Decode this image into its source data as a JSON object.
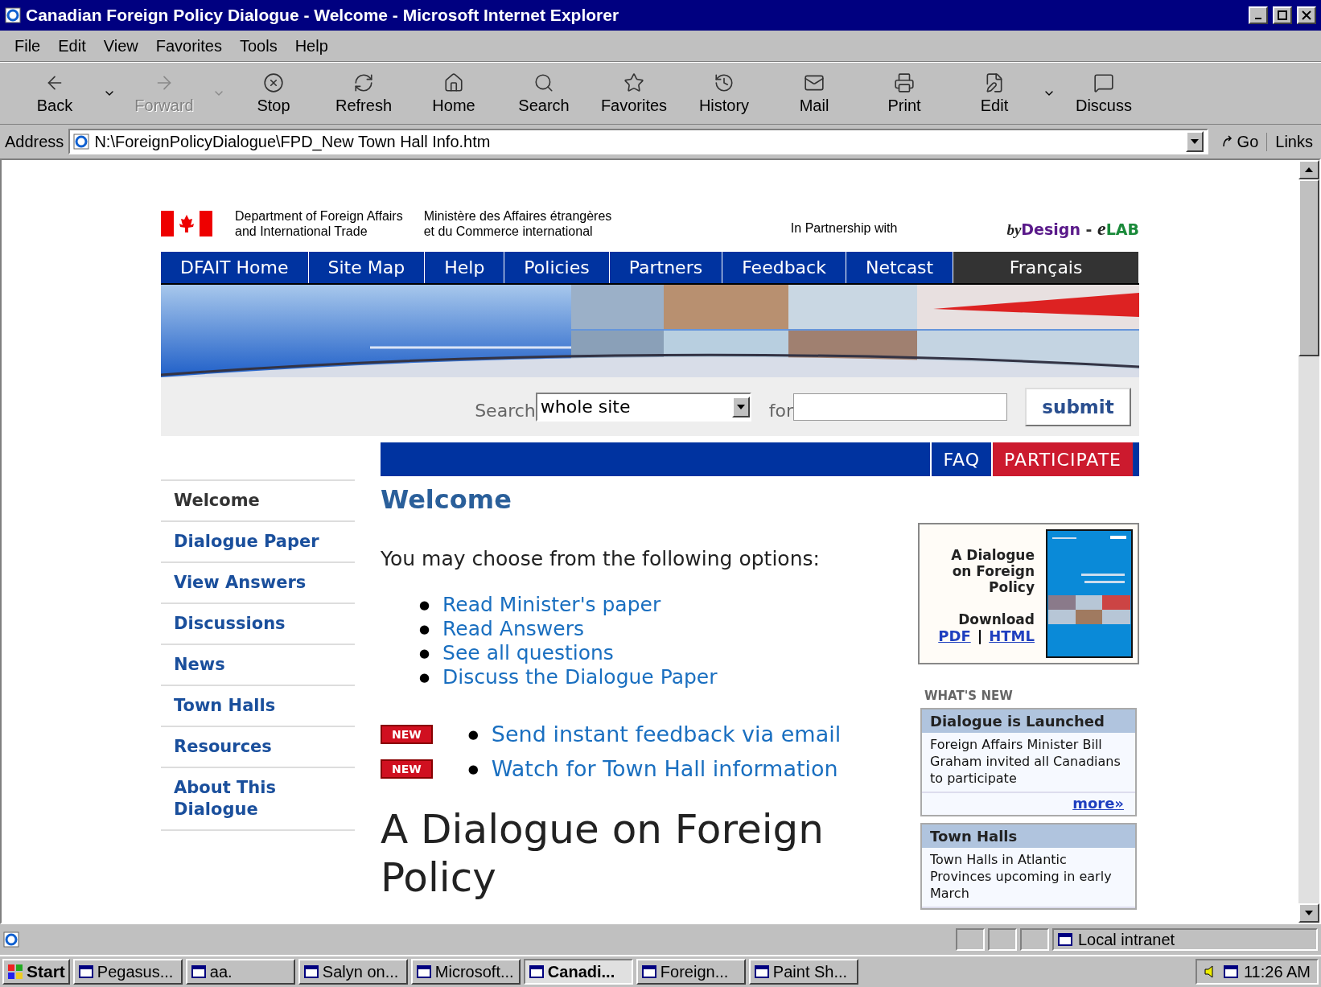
{
  "window": {
    "title": "Canadian Foreign Policy Dialogue - Welcome - Microsoft Internet Explorer"
  },
  "menu": [
    "File",
    "Edit",
    "View",
    "Favorites",
    "Tools",
    "Help"
  ],
  "toolbar": [
    {
      "label": "Back",
      "disabled": false,
      "dropdown": true
    },
    {
      "label": "Forward",
      "disabled": true,
      "dropdown": true
    },
    {
      "label": "Stop",
      "disabled": false,
      "dropdown": false
    },
    {
      "label": "Refresh",
      "disabled": false,
      "dropdown": false
    },
    {
      "label": "Home",
      "disabled": false,
      "dropdown": false
    },
    {
      "label": "Search",
      "disabled": false,
      "dropdown": false
    },
    {
      "label": "Favorites",
      "disabled": false,
      "dropdown": false
    },
    {
      "label": "History",
      "disabled": false,
      "dropdown": false
    },
    {
      "label": "Mail",
      "disabled": false,
      "dropdown": false
    },
    {
      "label": "Print",
      "disabled": false,
      "dropdown": false
    },
    {
      "label": "Edit",
      "disabled": false,
      "dropdown": true
    },
    {
      "label": "Discuss",
      "disabled": false,
      "dropdown": false
    }
  ],
  "address": {
    "label": "Address",
    "value": "N:\\ForeignPolicyDialogue\\FPD_New Town Hall Info.htm",
    "go": "Go",
    "links": "Links"
  },
  "header": {
    "dept_en": [
      "Department of Foreign Affairs",
      "and International Trade"
    ],
    "dept_fr": [
      "Ministère des Affaires étrangères",
      "et du Commerce international"
    ],
    "partnership": "In Partnership with",
    "partner_logo": [
      "by",
      "Design",
      " - ",
      "e",
      "LAB"
    ]
  },
  "nav": [
    {
      "label": "DFAIT Home",
      "kind": "link"
    },
    {
      "label": "Site Map",
      "kind": "link"
    },
    {
      "label": "Help",
      "kind": "link"
    },
    {
      "label": "Policies",
      "kind": "link"
    },
    {
      "label": "Partners",
      "kind": "link"
    },
    {
      "label": "Feedback",
      "kind": "link"
    },
    {
      "label": "Netcast",
      "kind": "link"
    },
    {
      "label": "Français",
      "kind": "language"
    }
  ],
  "search": {
    "label": "Search",
    "scope": "whole site",
    "for": "for",
    "button": "submit"
  },
  "action_bar": [
    {
      "label": "FAQ",
      "kind": "plain"
    },
    {
      "label": "PARTICIPATE",
      "kind": "highlight"
    }
  ],
  "sidebar": [
    {
      "label": "Welcome",
      "selected": true
    },
    {
      "label": "Dialogue Paper",
      "selected": false
    },
    {
      "label": "View Answers",
      "selected": false
    },
    {
      "label": "Discussions",
      "selected": false
    },
    {
      "label": "News",
      "selected": false
    },
    {
      "label": "Town Halls",
      "selected": false
    },
    {
      "label": "Resources",
      "selected": false
    },
    {
      "label": "About This Dialogue",
      "selected": false
    }
  ],
  "main": {
    "heading": "Welcome",
    "intro": "You may choose from the following options:",
    "options": [
      {
        "bullet": "●",
        "label": "Read Minister's paper"
      },
      {
        "bullet": "●",
        "label": "Read Answers"
      },
      {
        "bullet": "●",
        "label": "See all questions"
      },
      {
        "bullet": "●",
        "label": "Discuss the Dialogue Paper"
      }
    ],
    "new_items": [
      {
        "badge": "NEW",
        "bullet": "●",
        "label": "Send instant feedback via email"
      },
      {
        "badge": "NEW",
        "bullet": "●",
        "label": "Watch for Town Hall information"
      }
    ],
    "title": "A Dialogue on Foreign Policy"
  },
  "promo": {
    "title": "A Dialogue on Foreign Policy",
    "download": "Download",
    "links": [
      "PDF",
      "HTML"
    ],
    "separator": "|"
  },
  "whats_new": {
    "heading": "WHAT'S NEW",
    "items": [
      {
        "title": "Dialogue is Launched",
        "body": "Foreign Affairs Minister Bill Graham invited all Canadians to participate",
        "more": "more»"
      },
      {
        "title": "Town Halls",
        "body": "Town Halls in Atlantic Provinces upcoming in early March"
      }
    ]
  },
  "status_bar": {
    "zone": "Local intranet"
  },
  "taskbar": {
    "start": "Start",
    "tasks": [
      {
        "label": "Pegasus...",
        "selected": false
      },
      {
        "label": "aa.",
        "selected": false
      },
      {
        "label": "Salyn on...",
        "selected": false
      },
      {
        "label": "Microsoft...",
        "selected": false
      },
      {
        "label": "Canadi...",
        "selected": true
      },
      {
        "label": "Foreign...",
        "selected": false
      },
      {
        "label": "Paint Sh...",
        "selected": false
      }
    ],
    "time": "11:26 AM"
  }
}
